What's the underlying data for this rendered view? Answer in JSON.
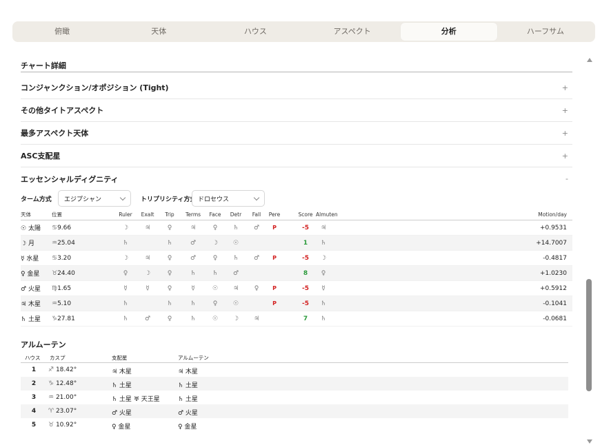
{
  "tabs": [
    {
      "label": "俯瞰",
      "active": false
    },
    {
      "label": "天体",
      "active": false
    },
    {
      "label": "ハウス",
      "active": false
    },
    {
      "label": "アスペクト",
      "active": false
    },
    {
      "label": "分析",
      "active": true
    },
    {
      "label": "ハーフサム",
      "active": false
    }
  ],
  "section_title": "チャート詳細",
  "accordions": [
    {
      "label": "コンジャンクション/オポジション (Tight)",
      "sign": "+"
    },
    {
      "label": "その他タイトアスペクト",
      "sign": "+"
    },
    {
      "label": "最多アスペクト天体",
      "sign": "+"
    },
    {
      "label": "ASC支配星",
      "sign": "+"
    },
    {
      "label": "エッセンシャルディグニティ",
      "sign": "-"
    }
  ],
  "controls": {
    "term_label": "ターム方式",
    "term_value": "エジプシャン",
    "trip_label": "トリプリシティ方式",
    "trip_value": "ドロセウス"
  },
  "dignity": {
    "headers": {
      "planet": "天体",
      "position": "位置",
      "ruler": "Ruler",
      "exalt": "Exalt",
      "trip": "Trip",
      "terms": "Terms",
      "face": "Face",
      "detr": "Detr",
      "fall": "Fall",
      "pere": "Pere",
      "score": "Score",
      "almuten": "Almuten",
      "motion": "Motion/day"
    },
    "rows": [
      {
        "glyph": "☉",
        "name": "太陽",
        "sign": "♋",
        "deg": "9.66",
        "ruler": "☽",
        "exalt": "♃",
        "trip": "♀",
        "terms": "♃",
        "face": "♀",
        "detr": "♄",
        "fall": "♂",
        "pere": "P",
        "score": "-5",
        "almuten": "♃",
        "motion": "+0.9531"
      },
      {
        "glyph": "☽",
        "name": "月",
        "sign": "♒",
        "deg": "25.04",
        "ruler": "♄",
        "exalt": "",
        "trip": "♄",
        "terms": "♂",
        "face": "☽",
        "detr": "☉",
        "fall": "",
        "pere": "",
        "score": "1",
        "almuten": "♄",
        "motion": "+14.7007"
      },
      {
        "glyph": "☿",
        "name": "水星",
        "sign": "♋",
        "deg": "3.20",
        "ruler": "☽",
        "exalt": "♃",
        "trip": "♀",
        "terms": "♂",
        "face": "♀",
        "detr": "♄",
        "fall": "♂",
        "pere": "P",
        "score": "-5",
        "almuten": "☽",
        "motion": "-0.4817"
      },
      {
        "glyph": "♀",
        "name": "金星",
        "sign": "♉",
        "deg": "24.40",
        "ruler": "♀",
        "exalt": "☽",
        "trip": "♀",
        "terms": "♄",
        "face": "♄",
        "detr": "♂",
        "fall": "",
        "pere": "",
        "score": "8",
        "almuten": "♀",
        "motion": "+1.0230"
      },
      {
        "glyph": "♂",
        "name": "火星",
        "sign": "♍",
        "deg": "1.65",
        "ruler": "☿",
        "exalt": "☿",
        "trip": "♀",
        "terms": "☿",
        "face": "☉",
        "detr": "♃",
        "fall": "♀",
        "pere": "P",
        "score": "-5",
        "almuten": "☿",
        "motion": "+0.5912"
      },
      {
        "glyph": "♃",
        "name": "木星",
        "sign": "♒",
        "deg": "5.10",
        "ruler": "♄",
        "exalt": "",
        "trip": "♄",
        "terms": "♄",
        "face": "♀",
        "detr": "☉",
        "fall": "",
        "pere": "P",
        "score": "-5",
        "almuten": "♄",
        "motion": "-0.1041"
      },
      {
        "glyph": "♄",
        "name": "土星",
        "sign": "♑",
        "deg": "27.81",
        "ruler": "♄",
        "exalt": "♂",
        "trip": "♀",
        "terms": "♄",
        "face": "☉",
        "detr": "☽",
        "fall": "♃",
        "pere": "",
        "score": "7",
        "almuten": "♄",
        "motion": "-0.0681"
      }
    ]
  },
  "almuten": {
    "title": "アルムーテン",
    "headers": {
      "house": "ハウス",
      "cusp": "カスプ",
      "ruler": "支配星",
      "almuten": "アルムーテン"
    },
    "rows": [
      {
        "house": "1",
        "sign": "♐",
        "deg": "18.42°",
        "ruler": "♃ 木星",
        "ruler2": "",
        "almuten": "♃ 木星"
      },
      {
        "house": "2",
        "sign": "♑",
        "deg": "12.48°",
        "ruler": "♄ 土星",
        "ruler2": "",
        "almuten": "♄ 土星"
      },
      {
        "house": "3",
        "sign": "♒",
        "deg": "21.00°",
        "ruler": "♄ 土星",
        "ruler2": "♅ 天王星",
        "almuten": "♄ 土星"
      },
      {
        "house": "4",
        "sign": "♈",
        "deg": "23.07°",
        "ruler": "♂ 火星",
        "ruler2": "",
        "almuten": "♂ 火星"
      },
      {
        "house": "5",
        "sign": "♉",
        "deg": "10.92°",
        "ruler": "♀ 金星",
        "ruler2": "",
        "almuten": "♀ 金星"
      }
    ]
  }
}
